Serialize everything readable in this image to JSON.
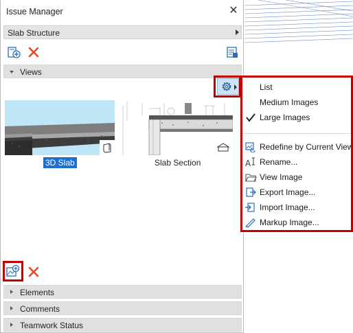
{
  "window": {
    "title": "Issue Manager",
    "close_glyph": "✕"
  },
  "issue_selector": {
    "value": "Slab Structure"
  },
  "toolbar": {
    "add_issue_icon": "add-issue-icon",
    "delete_icon": "delete-icon",
    "list_icon": "list-settings-icon"
  },
  "sections": {
    "views": "Views",
    "elements": "Elements",
    "comments": "Comments",
    "teamwork": "Teamwork Status"
  },
  "views": [
    {
      "label": "3D Slab",
      "selected": true,
      "icon": "3d-view-icon"
    },
    {
      "label": "Slab Section",
      "selected": false,
      "icon": "section-view-icon"
    }
  ],
  "menu": {
    "view_modes": [
      {
        "label": "List",
        "checked": false
      },
      {
        "label": "Medium Images",
        "checked": false
      },
      {
        "label": "Large Images",
        "checked": true
      }
    ],
    "actions": [
      {
        "label": "Redefine by Current View",
        "icon": "redefine-icon"
      },
      {
        "label": "Rename...",
        "icon": "rename-icon"
      },
      {
        "label": "View Image",
        "icon": "folder-icon"
      },
      {
        "label": "Export Image...",
        "icon": "export-icon"
      },
      {
        "label": "Import Image...",
        "icon": "import-icon"
      },
      {
        "label": "Markup Image...",
        "icon": "markup-icon"
      }
    ]
  },
  "colors": {
    "highlight": "#c00000",
    "selection": "#1f6fcf",
    "delete": "#e8431c",
    "icon_blue": "#2a6ebb"
  }
}
